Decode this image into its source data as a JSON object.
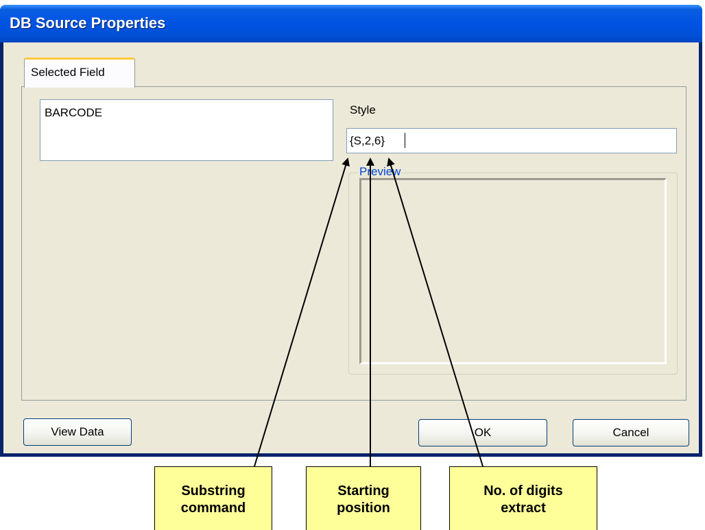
{
  "window": {
    "title": "DB Source Properties"
  },
  "tabs": [
    {
      "label": "Selected Field",
      "selected": true
    }
  ],
  "field_list": {
    "items": [
      "BARCODE"
    ]
  },
  "style": {
    "label": "Style",
    "value": "{S,2,6}"
  },
  "preview": {
    "label": "Preview"
  },
  "buttons": {
    "view_data": "View Data",
    "ok": "OK",
    "cancel": "Cancel"
  },
  "callouts": [
    {
      "text": "Substring\ncommand"
    },
    {
      "text": "Starting\nposition"
    },
    {
      "text": "No. of digits\nextract"
    }
  ],
  "colors": {
    "title_bar": "#0054e3",
    "dialog_background": "#ece9d8",
    "tab_highlight": "#ffc83c",
    "preview_label": "#0046d5",
    "callout_fill": "#ffff99"
  }
}
